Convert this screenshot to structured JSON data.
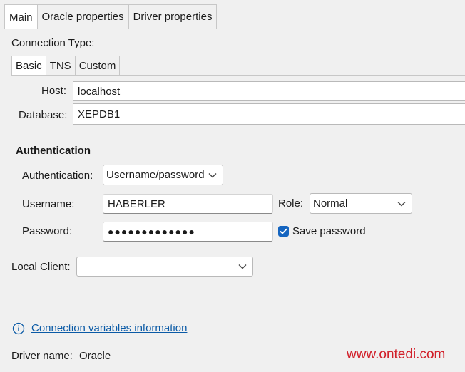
{
  "tabs": [
    {
      "label": "Main",
      "active": true
    },
    {
      "label": "Oracle properties",
      "active": false
    },
    {
      "label": "Driver properties",
      "active": false
    }
  ],
  "connection_type": {
    "label": "Connection Type:",
    "tabs": [
      {
        "label": "Basic",
        "active": true
      },
      {
        "label": "TNS",
        "active": false
      },
      {
        "label": "Custom",
        "active": false
      }
    ]
  },
  "host": {
    "label": "Host:",
    "value": "localhost"
  },
  "database": {
    "label": "Database:",
    "value": "XEPDB1"
  },
  "auth": {
    "section_title": "Authentication",
    "method_label": "Authentication:",
    "method_value": "Username/password",
    "username_label": "Username:",
    "username_value": "HABERLER",
    "role_label": "Role:",
    "role_value": "Normal",
    "password_label": "Password:",
    "password_value": "●●●●●●●●●●●●●",
    "save_password_label": "Save password",
    "save_password_checked": true
  },
  "local_client": {
    "label": "Local Client:",
    "value": ""
  },
  "info_link": {
    "text": "Connection variables information",
    "icon": "info-icon"
  },
  "driver": {
    "label": "Driver name:",
    "value": "Oracle"
  },
  "watermark": "www.ontedi.com",
  "colors": {
    "accent": "#1565c0",
    "link": "#0a5aa6",
    "watermark": "#d1202a"
  }
}
